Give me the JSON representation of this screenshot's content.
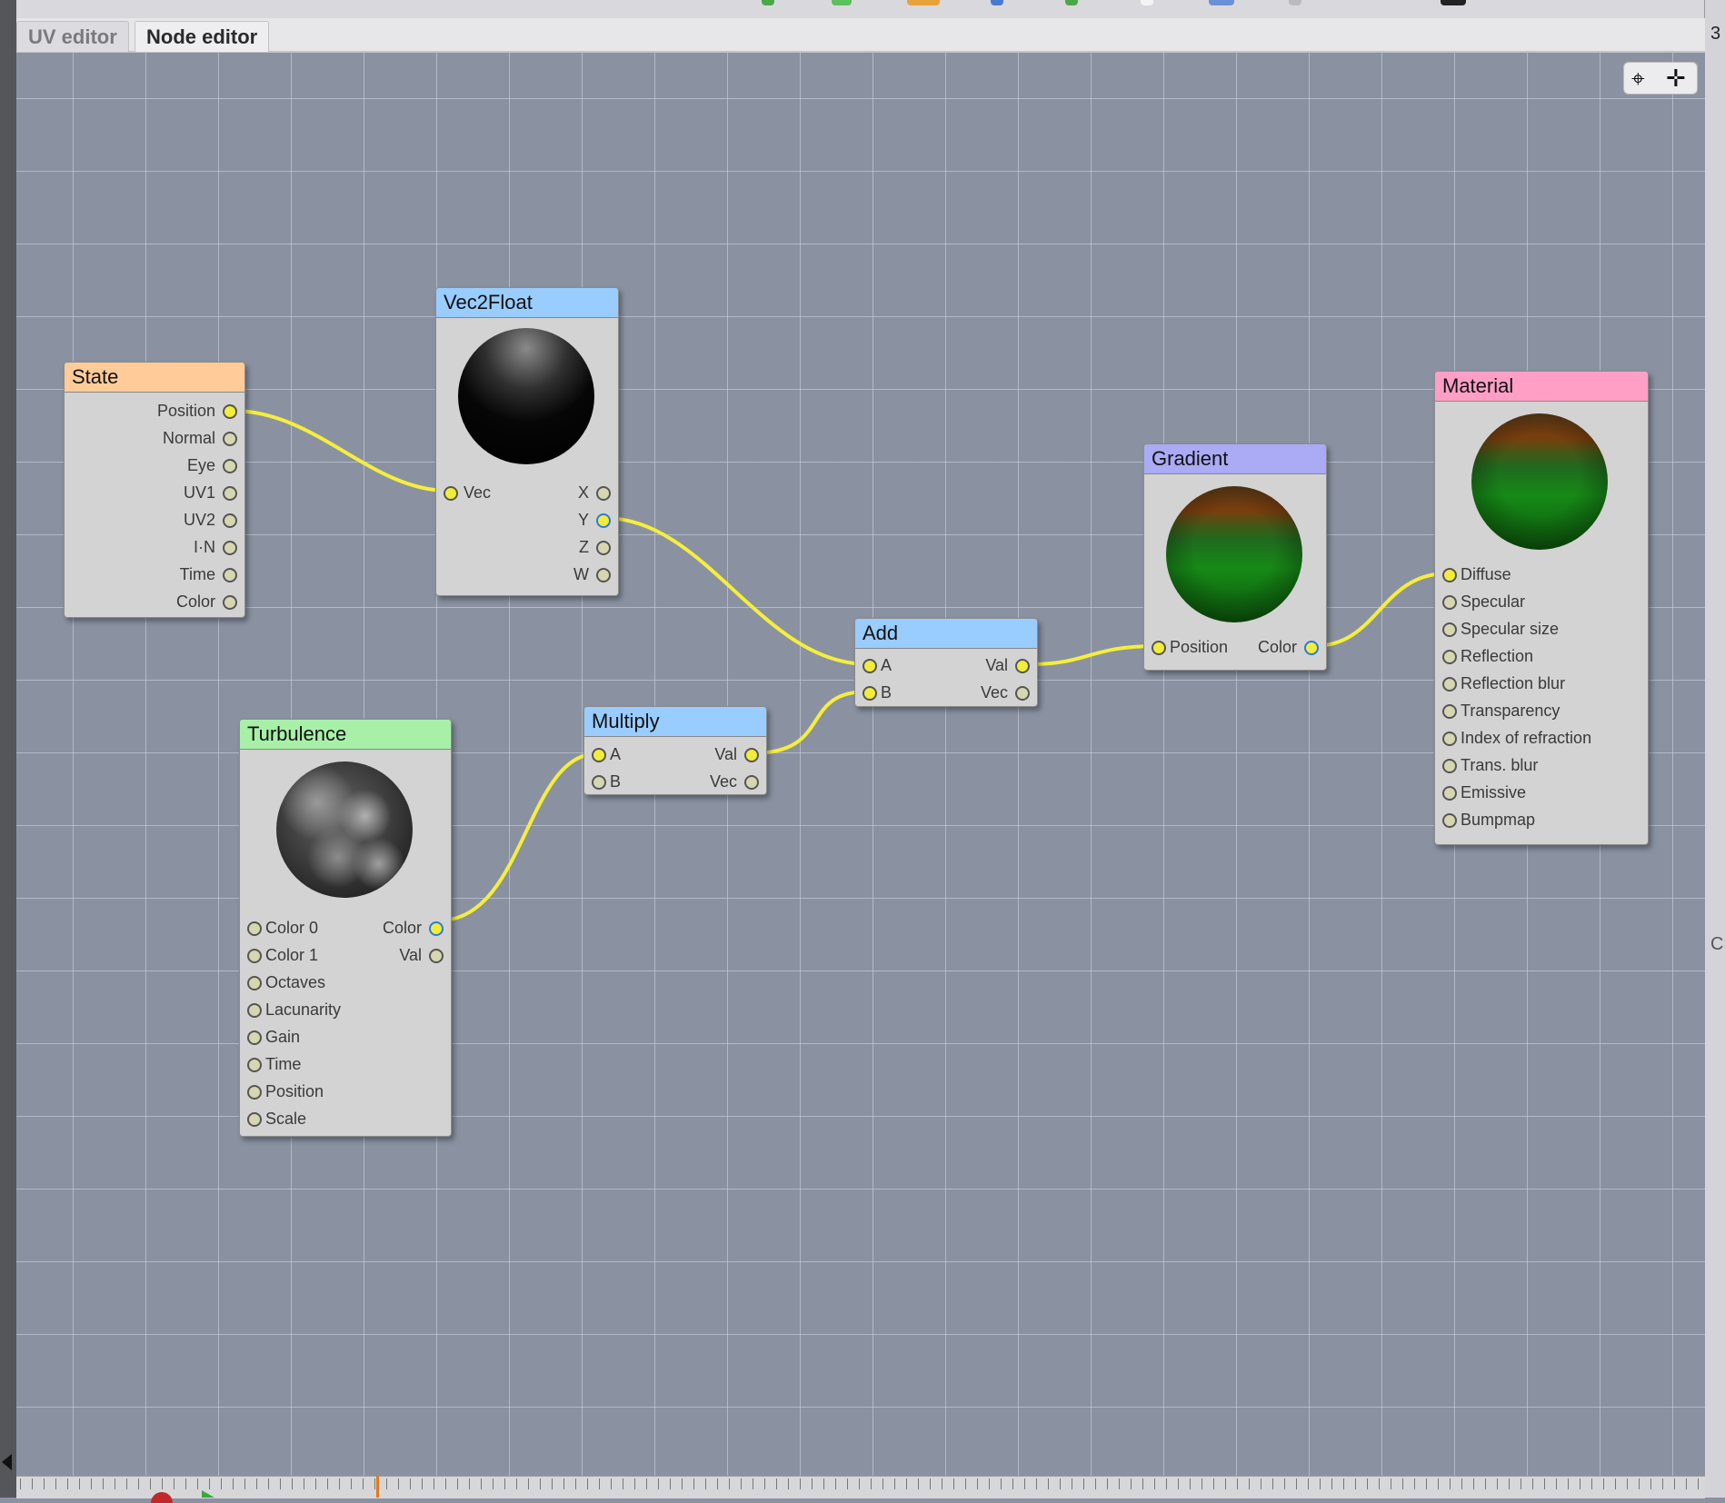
{
  "tabs": [
    {
      "label": "UV editor",
      "active": false
    },
    {
      "label": "Node editor",
      "active": true
    }
  ],
  "right_edge": {
    "top_char": "3",
    "mid_char": "C"
  },
  "nav_tools": {
    "locate_icon": "target-icon",
    "pan_icon": "move-arrows-icon"
  },
  "colors": {
    "state_header": "#ffcc99",
    "vec_header": "#99ccff",
    "turbulence_header": "#a8f0a8",
    "gradient_header": "#aaaaf5",
    "material_header": "#ff9fc5",
    "wire": "#f5ee3c",
    "background": "#8a92a2"
  },
  "nodes": {
    "state": {
      "title": "State",
      "outputs": [
        "Position",
        "Normal",
        "Eye",
        "UV1",
        "UV2",
        "I·N",
        "Time",
        "Color"
      ]
    },
    "vec2float": {
      "title": "Vec2Float",
      "inputs": [
        "Vec"
      ],
      "outputs": [
        "X",
        "Y",
        "Z",
        "W"
      ]
    },
    "turbulence": {
      "title": "Turbulence",
      "inputs": [
        "Color 0",
        "Color 1",
        "Octaves",
        "Lacunarity",
        "Gain",
        "Time",
        "Position",
        "Scale"
      ],
      "outputs": [
        "Color",
        "Val"
      ]
    },
    "multiply": {
      "title": "Multiply",
      "inputs": [
        "A",
        "B"
      ],
      "outputs": [
        "Val",
        "Vec"
      ]
    },
    "add": {
      "title": "Add",
      "inputs": [
        "A",
        "B"
      ],
      "outputs": [
        "Val",
        "Vec"
      ]
    },
    "gradient": {
      "title": "Gradient",
      "inputs": [
        "Position"
      ],
      "outputs": [
        "Color"
      ]
    },
    "material": {
      "title": "Material",
      "inputs": [
        "Diffuse",
        "Specular",
        "Specular size",
        "Reflection",
        "Reflection blur",
        "Transparency",
        "Index of refraction",
        "Trans. blur",
        "Emissive",
        "Bumpmap"
      ]
    }
  }
}
